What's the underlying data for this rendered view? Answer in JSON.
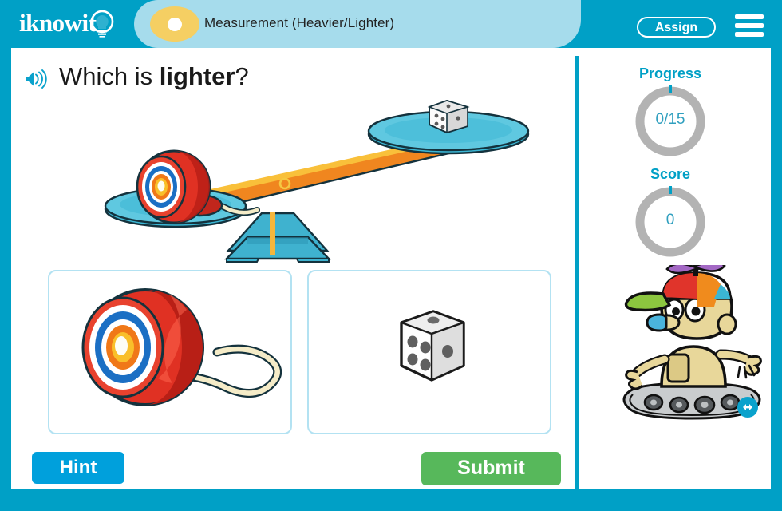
{
  "app": {
    "logo_text": "iknowit",
    "logo_icon": "lightbulb-icon"
  },
  "header": {
    "badge_icon": "yellow-dot-badge",
    "title": "Measurement (Heavier/Lighter)",
    "assign_label": "Assign",
    "menu_icon": "hamburger-menu-icon",
    "bar_color": "#00a0c6",
    "pill_color": "#a6dcec",
    "badge_color": "#f5cf63"
  },
  "question": {
    "speaker_icon": "speaker-audio-icon",
    "prefix": "Which is ",
    "emphasis": "lighter",
    "suffix": "?"
  },
  "illustration": {
    "name": "balance-scale",
    "left_pan_item": "red-yoyo",
    "right_pan_item": "white-die",
    "tilt": "left-side-down",
    "beam_color": "#f0861f",
    "pan_color": "#3bb6d4",
    "base_color": "#2f9fc0"
  },
  "choices": [
    {
      "id": "choice-yoyo",
      "icon": "red-yoyo-icon",
      "label": "Yo-yo",
      "selected": false
    },
    {
      "id": "choice-die",
      "icon": "white-die-icon",
      "label": "Die",
      "selected": false
    }
  ],
  "actions": {
    "hint_label": "Hint",
    "submit_label": "Submit",
    "hint_color": "#00a0dc",
    "submit_color": "#57b85b"
  },
  "sidebar": {
    "progress_label": "Progress",
    "progress_value": "0/15",
    "score_label": "Score",
    "score_value": "0",
    "ring_color": "#b3b3b3",
    "ring_tick_color": "#00a0c6",
    "accent_color": "#00a0c6",
    "mascot_icon": "robot-mascot-propeller-hat",
    "nav_arrow_icon": "left-right-arrow-icon"
  }
}
